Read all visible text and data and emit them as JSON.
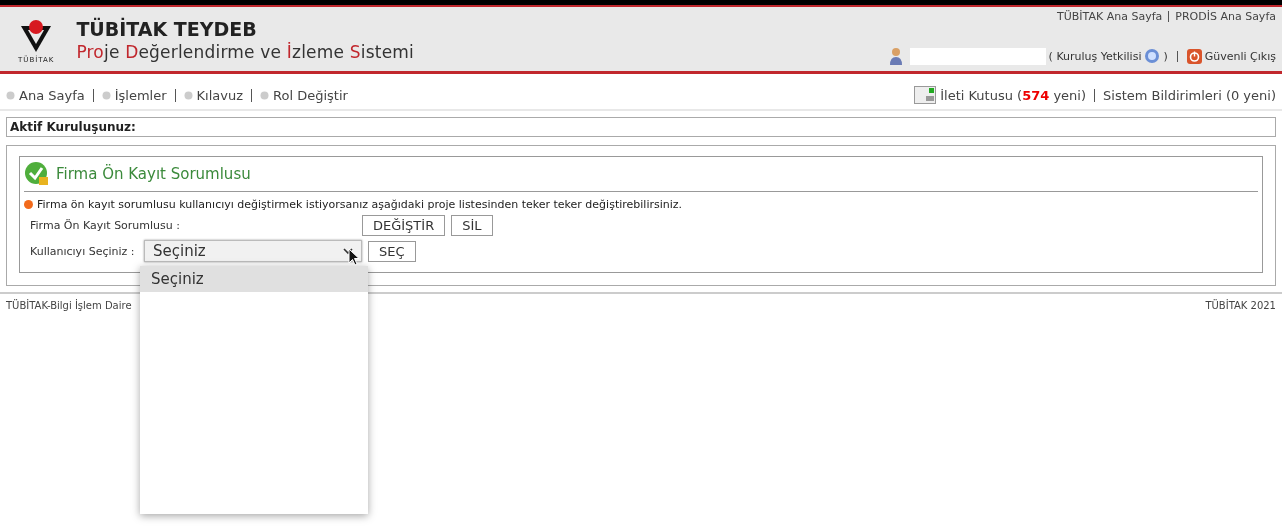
{
  "header": {
    "logo_caption": "TÜBİTAK",
    "title": "TÜBİTAK TEYDEB",
    "subtitle_parts": [
      {
        "text": "Pro",
        "accent": true
      },
      {
        "text": "je ",
        "accent": false
      },
      {
        "text": "D",
        "accent": true
      },
      {
        "text": "eğerlendirme ve ",
        "accent": false
      },
      {
        "text": "İ",
        "accent": true
      },
      {
        "text": "zleme ",
        "accent": false
      },
      {
        "text": "S",
        "accent": true
      },
      {
        "text": "istemi",
        "accent": false
      }
    ],
    "top_links": [
      "TÜBİTAK Ana Sayfa",
      "PRODİS Ana Sayfa"
    ],
    "role_open": "( Kuruluş Yetkilisi",
    "role_close": ")",
    "logout": "Güvenli Çıkış"
  },
  "nav": {
    "items": [
      "Ana Sayfa",
      "İşlemler",
      "Kılavuz",
      "Rol Değiştir"
    ],
    "inbox_prefix": "İleti Kutusu (",
    "inbox_count": "574",
    "inbox_suffix": "yeni)",
    "notifications": "Sistem Bildirimleri (0 yeni)"
  },
  "active_org": {
    "label": "Aktif Kuruluşunuz:"
  },
  "panel": {
    "title": "Firma Ön Kayıt Sorumlusu",
    "info": "Firma ön kayıt sorumlusu kullanıcıyı değiştirmek istiyorsanız aşağıdaki proje listesinden teker teker değiştirebilirsiniz.",
    "rows": [
      {
        "kind": "buttons",
        "label": "Firma Ön Kayıt Sorumlusu :",
        "buttons": [
          "DEĞİŞTİR",
          "SİL"
        ]
      },
      {
        "kind": "select",
        "label": "Kullanıcıyı Seçiniz :",
        "value": "Seçiniz",
        "expanded": true,
        "options": [
          {
            "label": "Seçiniz",
            "selected": true
          }
        ],
        "buttons": [
          "SEÇ"
        ]
      }
    ]
  },
  "footer": {
    "left": "TÜBİTAK-Bilgi İşlem Daire",
    "right": "TÜBİTAK 2021"
  }
}
